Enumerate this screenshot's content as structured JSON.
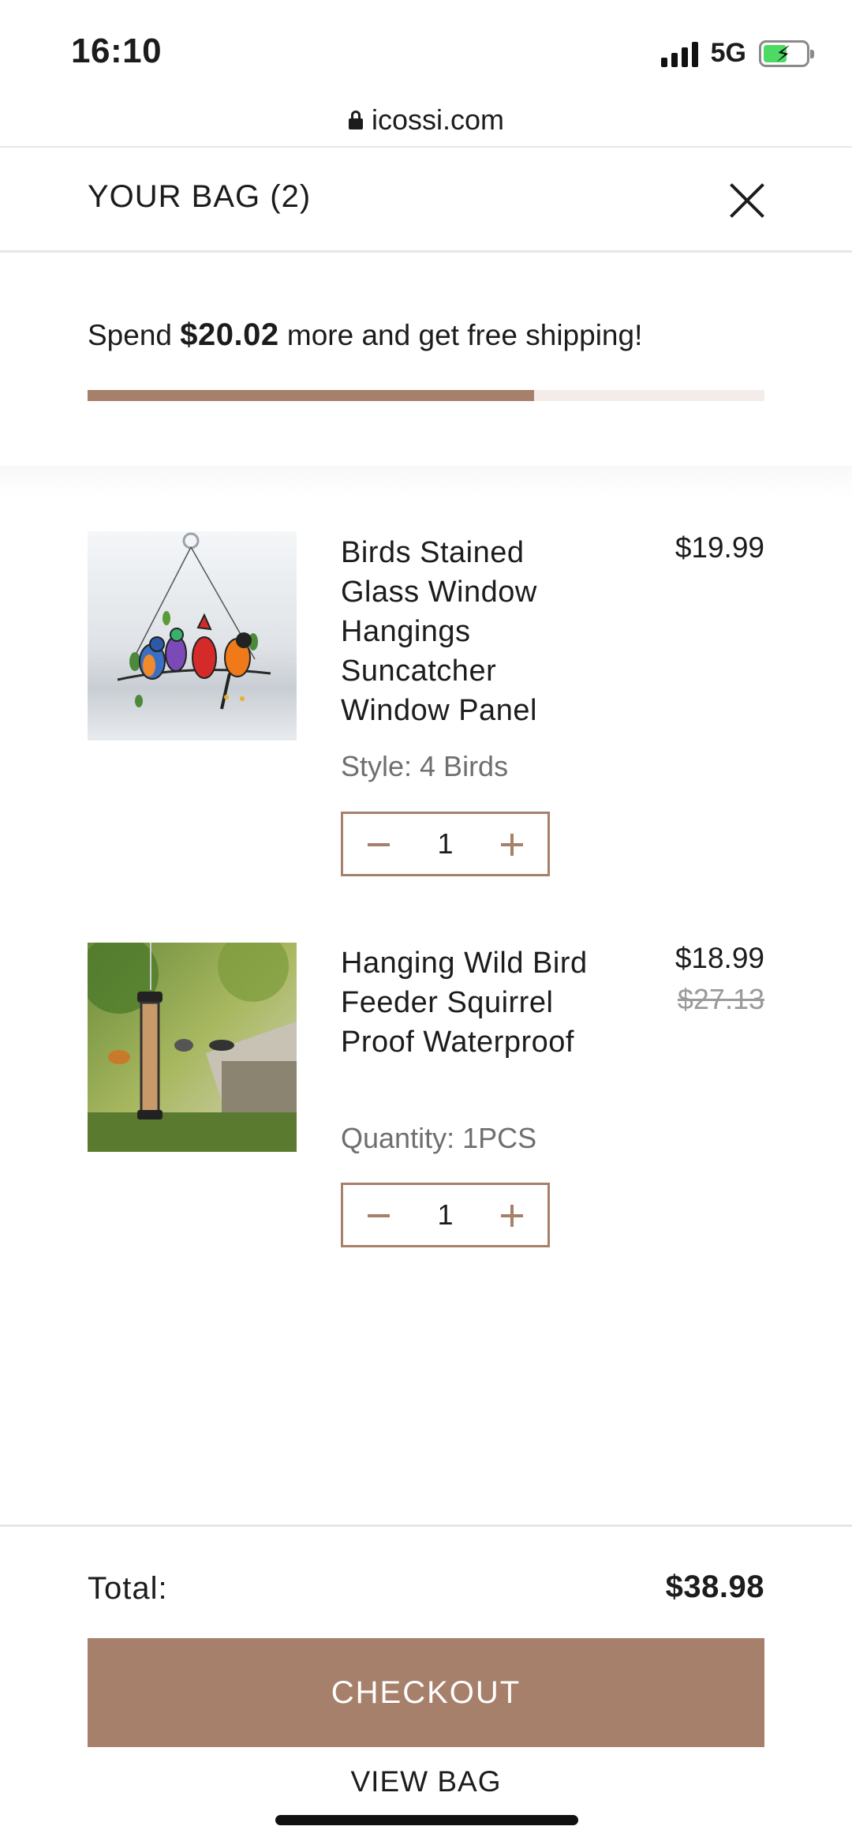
{
  "status_bar": {
    "time": "16:10",
    "network": "5G",
    "battery_level": 0.55,
    "battery_charging": true
  },
  "browser": {
    "url": "icossi.com"
  },
  "bag": {
    "title": "YOUR BAG (2)"
  },
  "shipping": {
    "prefix": "Spend ",
    "amount": "$20.02",
    "suffix": " more and get free shipping!",
    "progress": 0.66,
    "accent_color": "#a6806b",
    "track_color": "#f4ece8"
  },
  "items": [
    {
      "name": "Birds Stained Glass Window Hangings Suncatcher Window Panel",
      "price": "$19.99",
      "variant": "Style: 4 Birds",
      "quantity": "1"
    },
    {
      "name": "Hanging Wild Bird Feeder Squirrel Proof Waterproof",
      "price": "$18.99",
      "compare_price": "$27.13",
      "variant": "Quantity: 1PCS",
      "quantity": "1"
    }
  ],
  "footer": {
    "total_label": "Total:",
    "total_value": "$38.98",
    "checkout_label": "CHECKOUT",
    "view_bag_label": "VIEW BAG"
  }
}
